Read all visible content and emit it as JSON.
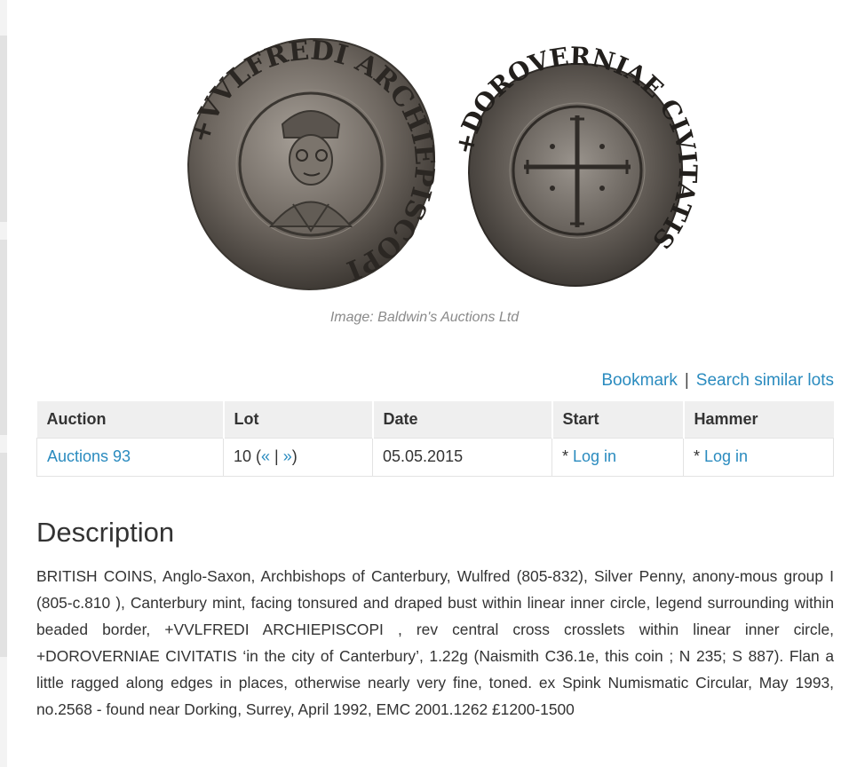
{
  "image": {
    "caption": "Image: Baldwin's Auctions Ltd",
    "coin_obverse_icon": "coin-obverse-bust",
    "coin_reverse_icon": "coin-reverse-cross",
    "obverse_legend": "+VVLFREDI ARCHIEPISCOPI",
    "reverse_legend": "+DOROVERNIAE CIVITATIS"
  },
  "actions": {
    "bookmark": "Bookmark",
    "separator": "|",
    "similar": "Search similar lots"
  },
  "table": {
    "headers": [
      "Auction",
      "Lot",
      "Date",
      "Start",
      "Hammer"
    ],
    "row": {
      "auction": "Auctions 93",
      "lot_number": "10 (",
      "lot_prev": "«",
      "lot_sep": " | ",
      "lot_next": "»",
      "lot_close": ")",
      "date": "05.05.2015",
      "start_prefix": "* ",
      "start_link": "Log in",
      "hammer_prefix": "* ",
      "hammer_link": "Log in"
    }
  },
  "description": {
    "title": "Description",
    "body": "BRITISH COINS, Anglo-Saxon, Archbishops of Canterbury, Wulfred (805-832), Silver Penny, anony-mous group I (805-c.810 ), Canterbury mint, facing tonsured and draped bust within linear inner circle, legend surrounding within beaded border, +VVLFREDI ARCHIEPISCOPI , rev central cross crosslets within linear inner circle, +DOROVERNIAE CIVITATIS ‘in the city of Canterbury’, 1.22g (Naismith C36.1e, this coin ; N 235; S 887). Flan a little ragged along edges in places, otherwise nearly very fine, toned. ex Spink Numismatic Circular, May 1993, no.2568 - found near Dorking, Surrey, April 1992, EMC 2001.1262 £1200-1500"
  },
  "colors": {
    "link": "#2a8bbf",
    "text": "#333333",
    "table_header_bg": "#efefef",
    "coin_silver": "#6e6760"
  }
}
